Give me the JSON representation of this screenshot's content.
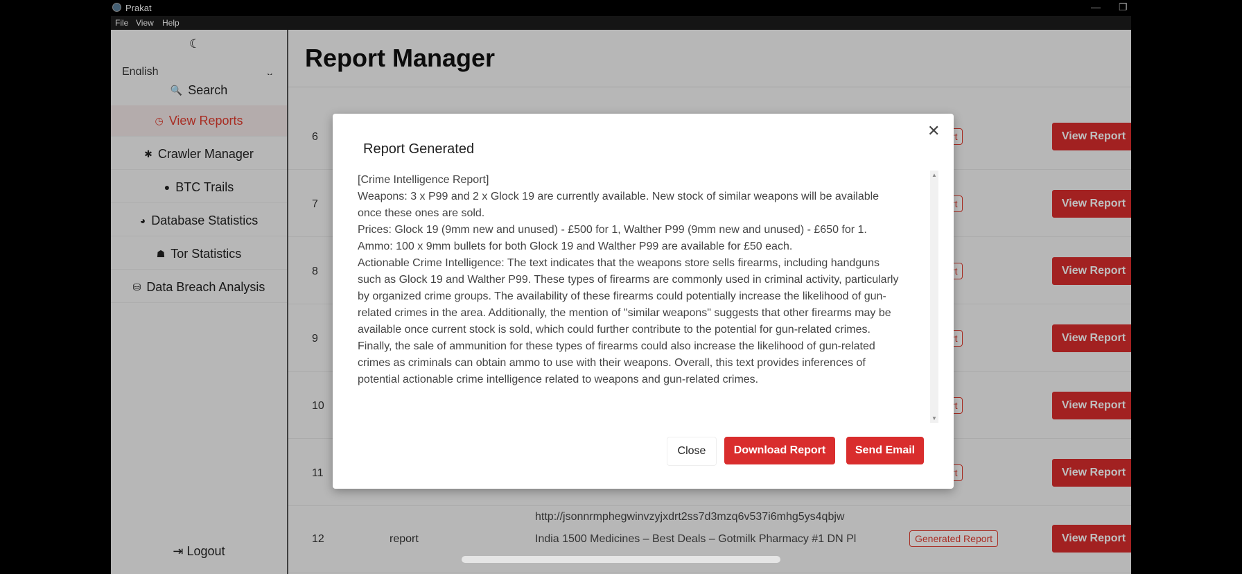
{
  "window": {
    "title": "Prakat",
    "minimize": "—",
    "restore": "❐"
  },
  "menu": [
    "File",
    "View",
    "Help"
  ],
  "sidebar": {
    "theme_icon": "☾",
    "language": "English",
    "items": [
      {
        "label": "Search",
        "icon": "🔍"
      },
      {
        "label": "View Reports",
        "icon": "◷"
      },
      {
        "label": "Crawler Manager",
        "icon": "✱"
      },
      {
        "label": "BTC Trails",
        "icon": "●"
      },
      {
        "label": "Database Statistics",
        "icon": "◕"
      },
      {
        "label": "Tor Statistics",
        "icon": "☗"
      },
      {
        "label": "Data Breach Analysis",
        "icon": "⛁"
      }
    ],
    "logout": "Logout",
    "logout_icon": "⇥"
  },
  "page_title": "Report Manager",
  "table": {
    "rows": [
      {
        "num": "6",
        "badge": "ed Report",
        "action": "View Report"
      },
      {
        "num": "7",
        "badge": "ed Report",
        "action": "View Report"
      },
      {
        "num": "8",
        "badge": "ed Report",
        "action": "View Report"
      },
      {
        "num": "9",
        "badge": "ed Report",
        "action": "View Report"
      },
      {
        "num": "10",
        "badge": "ed Report",
        "action": "View Report"
      },
      {
        "num": "11",
        "badge": "ed Report",
        "action": "View Report"
      },
      {
        "num": "12",
        "type": "report",
        "link": "http://jsonnrmphegwinvzyjxdrt2ss7d3mzq6v537i6mhg5ys4qbjw",
        "link_title": "India 1500 Medicines – Best Deals – Gotmilk Pharmacy #1 DN Pl",
        "badge": "Generated Report",
        "action": "View Report"
      }
    ]
  },
  "modal": {
    "title": "Report Generated",
    "close_icon": "✕",
    "paragraphs": [
      "[Crime Intelligence Report]",
      "Weapons: 3 x P99 and 2 x Glock 19 are currently available. New stock of similar weapons will be available once these ones are sold.",
      "Prices: Glock 19 (9mm new and unused) - £500 for 1, Walther P99 (9mm new and unused) - £650 for 1. Ammo: 100 x 9mm bullets for both Glock 19 and Walther P99 are available for £50 each.",
      "Actionable Crime Intelligence: The text indicates that the weapons store sells firearms, including handguns such as Glock 19 and Walther P99. These types of firearms are commonly used in criminal activity, particularly by organized crime groups. The availability of these firearms could potentially increase the likelihood of gun-related crimes in the area. Additionally, the mention of \"similar weapons\" suggests that other firearms may be available once current stock is sold, which could further contribute to the potential for gun-related crimes. Finally, the sale of ammunition for these types of firearms could also increase the likelihood of gun-related crimes as criminals can obtain ammo to use with their weapons. Overall, this text provides inferences of potential actionable crime intelligence related to weapons and gun-related crimes."
    ],
    "buttons": {
      "close": "Close",
      "download": "Download Report",
      "send": "Send Email"
    }
  }
}
